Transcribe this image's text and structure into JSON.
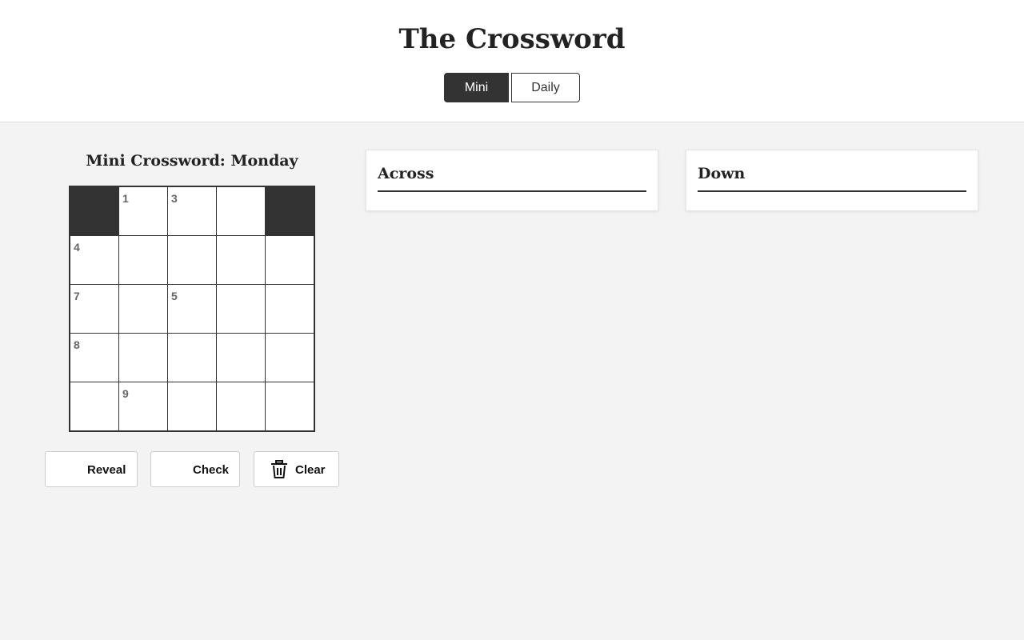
{
  "header": {
    "title": "The Crossword",
    "modes": [
      {
        "label": "Mini",
        "active": true
      },
      {
        "label": "Daily",
        "active": false
      }
    ]
  },
  "puzzle": {
    "title": "Mini Crossword: Monday",
    "grid": [
      [
        {
          "block": true
        },
        {
          "num": "1"
        },
        {
          "num": "3"
        },
        {},
        {
          "block": true
        }
      ],
      [
        {
          "num": "4"
        },
        {},
        {},
        {},
        {}
      ],
      [
        {
          "num": "7"
        },
        {},
        {
          "num": "5"
        },
        {},
        {}
      ],
      [
        {
          "num": "8"
        },
        {},
        {},
        {},
        {}
      ],
      [
        {},
        {
          "num": "9"
        },
        {},
        {},
        {}
      ]
    ]
  },
  "actions": {
    "reveal_label": "Reveal",
    "check_label": "Check",
    "clear_label": "Clear"
  },
  "clues": {
    "across_heading": "Across",
    "down_heading": "Down"
  },
  "icons": {
    "clear": "trash-icon"
  },
  "colors": {
    "accent": "#333333",
    "block": "#333333",
    "background": "#f3f3f3"
  }
}
